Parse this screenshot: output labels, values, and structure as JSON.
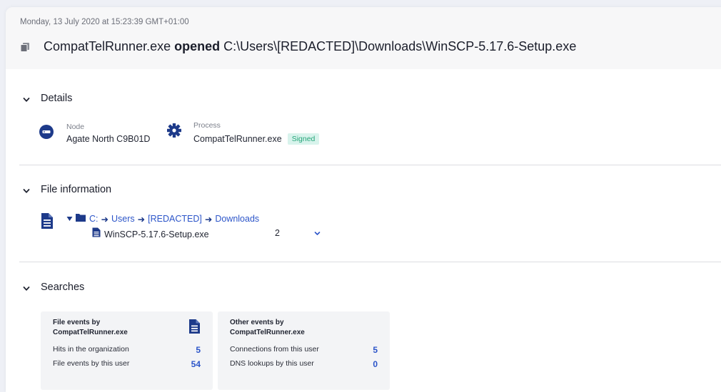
{
  "header": {
    "timestamp": "Monday, 13 July 2020 at 15:23:39 GMT+01:00",
    "title_process": "CompatTelRunner.exe",
    "title_action": "opened",
    "title_path": "C:\\Users\\[REDACTED]\\Downloads\\WinSCP-5.17.6-Setup.exe",
    "icon": "files-icon"
  },
  "details": {
    "heading": "Details",
    "node_label": "Node",
    "node_value": "Agate North C9B01D",
    "process_label": "Process",
    "process_value": "CompatTelRunner.exe",
    "signed_badge": "Signed"
  },
  "file_info": {
    "heading": "File information",
    "path": {
      "drive": "C:",
      "sep": "➜",
      "seg1": "Users",
      "seg2": "[REDACTED]",
      "seg3": "Downloads"
    },
    "file_name": "WinSCP-5.17.6-Setup.exe",
    "file_count": "2"
  },
  "searches": {
    "heading": "Searches",
    "cards": [
      {
        "title_line1": "File events by",
        "title_line2": "CompatTelRunner.exe",
        "rows": [
          {
            "label": "Hits in the organization",
            "value": "5"
          },
          {
            "label": "File events by this user",
            "value": "54"
          }
        ]
      },
      {
        "title_line1": "Other events by",
        "title_line2": "CompatTelRunner.exe",
        "rows": [
          {
            "label": "Connections from this user",
            "value": "5"
          },
          {
            "label": "DNS lookups by this user",
            "value": "0"
          }
        ]
      }
    ]
  },
  "colors": {
    "accent": "#2c55c9",
    "icon_navy": "#1d3a8a",
    "signed_bg": "#d8f3ec",
    "signed_fg": "#27a67a"
  }
}
